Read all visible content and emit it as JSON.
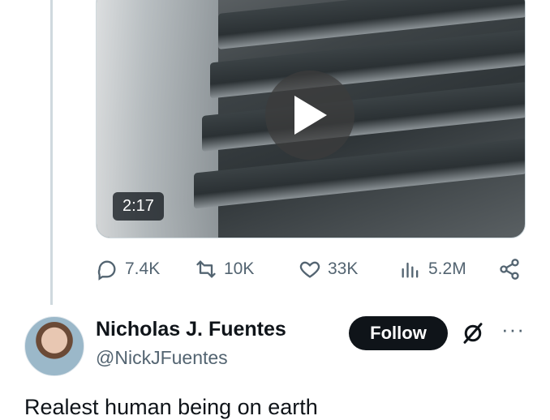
{
  "video": {
    "duration": "2:17"
  },
  "actions": {
    "replies": "7.4K",
    "reposts": "10K",
    "likes": "33K",
    "views": "5.2M"
  },
  "author": {
    "name": "Nicholas J. Fuentes",
    "handle": "@NickJFuentes",
    "follow_label": "Follow"
  },
  "tweet": {
    "text": "Realest human being on earth"
  },
  "icons": {
    "play": "play-icon",
    "reply": "reply-icon",
    "repost": "repost-icon",
    "like": "heart-icon",
    "views": "views-icon",
    "share": "share-icon",
    "grok": "grok-icon",
    "more": "more-icon"
  },
  "colors": {
    "text": "#0f1419",
    "muted": "#536471",
    "button": "#0f1419"
  }
}
